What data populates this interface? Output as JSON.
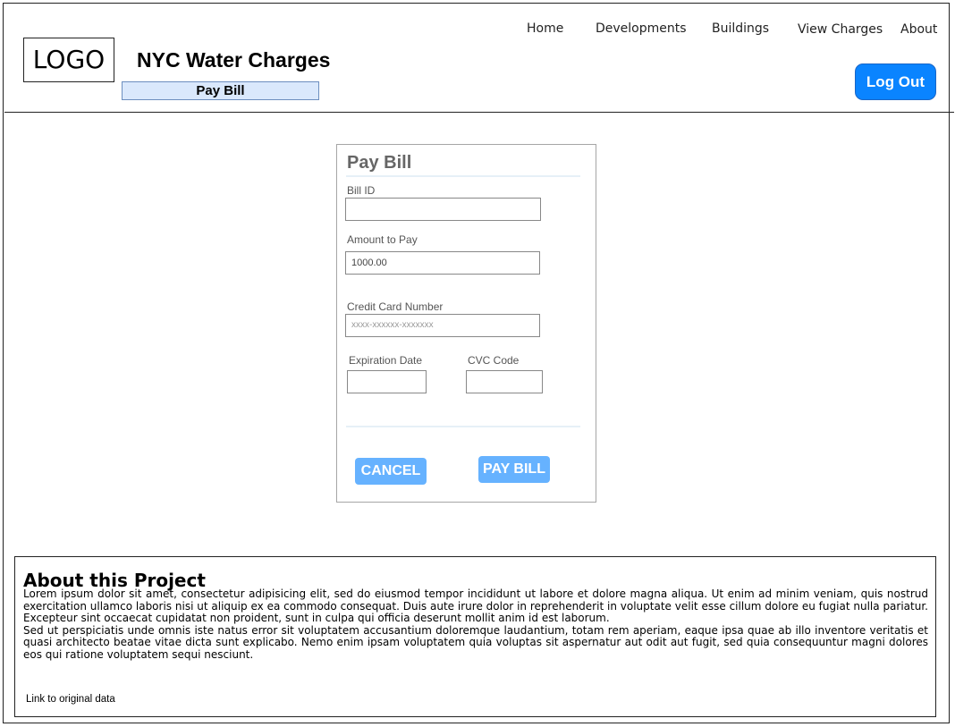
{
  "header": {
    "logo": "LOGO",
    "title": "NYC Water Charges",
    "page_tab": "Pay Bill",
    "nav": {
      "home": "Home",
      "developments": "Developments",
      "buildings": "Buildings",
      "view_charges": "View Charges",
      "about": "About"
    },
    "logout": "Log Out"
  },
  "form": {
    "title": "Pay Bill",
    "bill_id": {
      "label": "Bill ID",
      "value": ""
    },
    "amount": {
      "label": "Amount to Pay",
      "value": "1000.00"
    },
    "card": {
      "label": "Credit Card Number",
      "placeholder": "xxxx-xxxxxx-xxxxxxx"
    },
    "expiration": {
      "label": "Expiration Date",
      "value": ""
    },
    "cvc": {
      "label": "CVC Code",
      "value": ""
    },
    "cancel": "CANCEL",
    "pay": "PAY BILL"
  },
  "about": {
    "title": "About this Project",
    "paragraph1": "Lorem ipsum dolor sit amet, consectetur adipisicing elit, sed do eiusmod tempor incididunt ut labore et dolore magna aliqua. Ut enim ad minim veniam, quis nostrud exercitation ullamco laboris nisi ut aliquip ex ea commodo consequat. Duis aute irure dolor in reprehenderit in voluptate velit esse cillum dolore eu fugiat nulla pariatur. Excepteur sint occaecat cupidatat non proident, sunt in culpa qui officia deserunt mollit anim id est laborum.",
    "paragraph2": "Sed ut perspiciatis unde omnis iste natus error sit voluptatem accusantium doloremque laudantium, totam rem aperiam, eaque ipsa quae ab illo inventore veritatis et quasi architecto beatae vitae dicta sunt explicabo. Nemo enim ipsam voluptatem quia voluptas sit aspernatur aut odit aut fugit, sed quia consequuntur magni dolores eos qui ratione voluptatem sequi nesciunt.",
    "link": "Link to original data"
  },
  "colors": {
    "accent": "#0a84ff",
    "button": "#66b2ff",
    "tab_bg": "#dae8fc"
  }
}
